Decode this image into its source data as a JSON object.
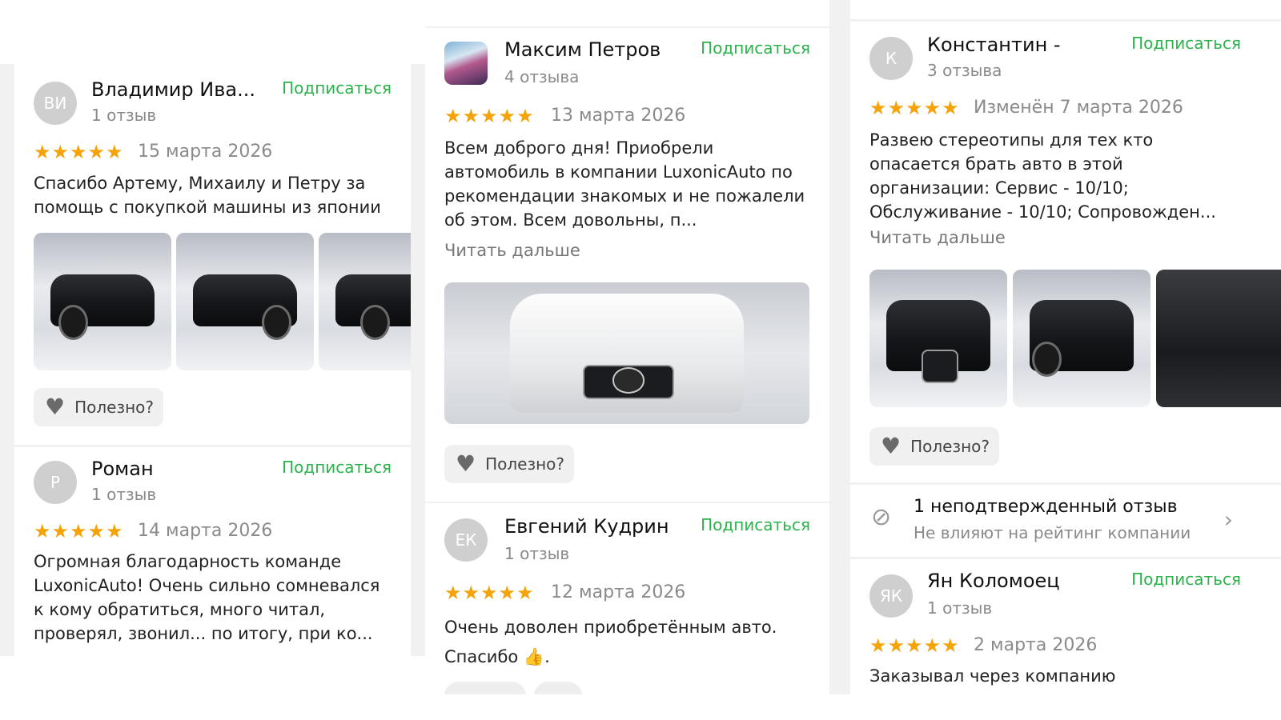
{
  "col1": {
    "reviews": [
      {
        "avatar": "ВИ",
        "name": "Владимир Ива...",
        "count": "1 отзыв",
        "subscribe": "Подписаться",
        "date": "15 марта 2026",
        "text": "Спасибо Артему, Михаилу и Петру за помощь с покупкой машины из японии",
        "helpful": "Полезно?"
      },
      {
        "avatar": "Р",
        "name": "Роман",
        "count": "1 отзыв",
        "subscribe": "Подписаться",
        "date": "14 марта 2026",
        "text": "Огромная благодарность команде LuxonicAuto! Очень сильно сомневался к кому обратиться, много читал, проверял, звонил... по итогу, при ко..."
      }
    ]
  },
  "col2": {
    "reviews": [
      {
        "name": "Максим Петров",
        "count": "4 отзыва",
        "subscribe": "Подписаться",
        "date": "13 марта 2026",
        "text": "Всем доброго дня! Приобрели автомобиль в компании LuxonicAuto по рекомендации знакомых и не пожалели об этом. Всем довольны, п...",
        "more": "Читать дальше",
        "helpful": "Полезно?"
      },
      {
        "avatar": "ЕК",
        "name": "Евгений Кудрин",
        "count": "1 отзыв",
        "subscribe": "Подписаться",
        "date": "12 марта 2026",
        "text": "Очень доволен приобретённым авто. Спасибо 👍."
      }
    ]
  },
  "col3": {
    "reviews": [
      {
        "avatar": "К",
        "name": "Константин -",
        "count": "3 отзыва",
        "subscribe": "Подписаться",
        "date": "Изменён 7 марта 2026",
        "text": "Развею стереотипы для тех кто опасается брать авто в этой организации: Сервис - 10/10; Обслуживание - 10/10; Сопровожден...",
        "more": "Читать дальше",
        "helpful": "Полезно?"
      },
      {
        "avatar": "ЯК",
        "name": "Ян Коломоец",
        "count": "1 отзыв",
        "subscribe": "Подписаться",
        "date": "2 марта 2026",
        "text": "Заказывал через компанию"
      }
    ],
    "unverified": {
      "title": "1 неподтвержденный отзыв",
      "subtitle": "Не влияют на рейтинг компании"
    }
  },
  "rating_stars": 5,
  "colors": {
    "subscribe": "#2bb34b",
    "star": "#f5a30a"
  }
}
